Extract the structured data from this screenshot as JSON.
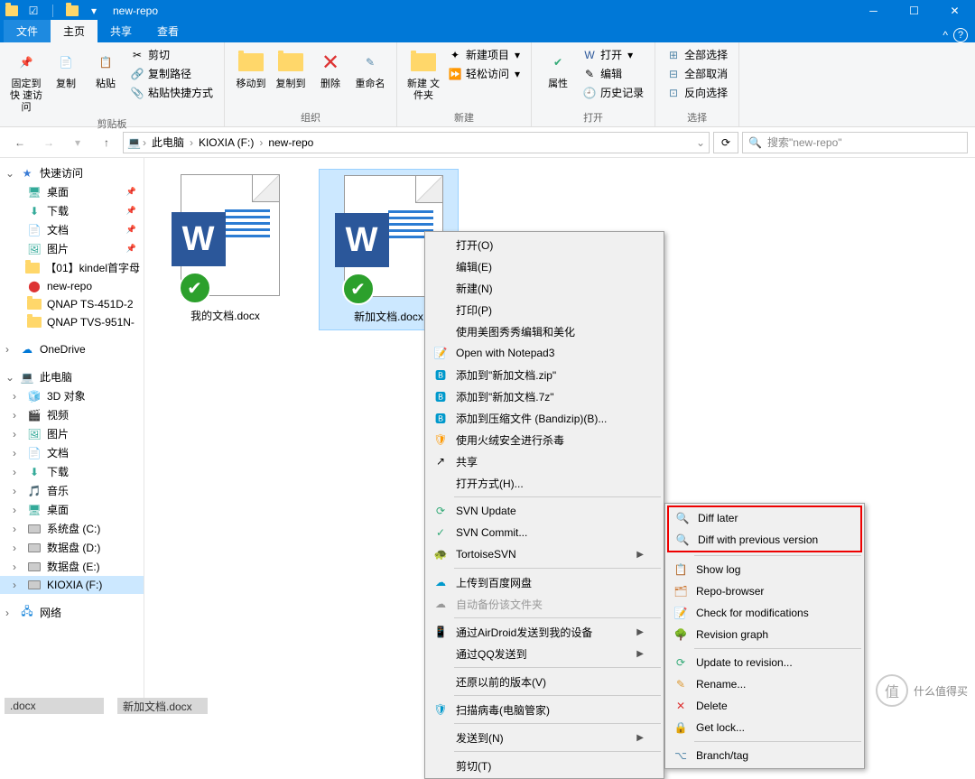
{
  "window": {
    "title": "new-repo"
  },
  "tabs": {
    "file": "文件",
    "home": "主页",
    "share": "共享",
    "view": "查看"
  },
  "ribbon": {
    "clipboard": {
      "label": "剪贴板",
      "pin": "固定到快\n速访问",
      "copy": "复制",
      "paste": "粘贴",
      "cut": "剪切",
      "copypath": "复制路径",
      "pasteshortcut": "粘贴快捷方式"
    },
    "organize": {
      "label": "组织",
      "moveto": "移动到",
      "copyto": "复制到",
      "delete": "删除",
      "rename": "重命名"
    },
    "new": {
      "label": "新建",
      "newfolder": "新建\n文件夹",
      "newitem": "新建项目",
      "easyaccess": "轻松访问"
    },
    "open": {
      "label": "打开",
      "properties": "属性",
      "open": "打开",
      "edit": "编辑",
      "history": "历史记录"
    },
    "select": {
      "label": "选择",
      "selectall": "全部选择",
      "selectnone": "全部取消",
      "invert": "反向选择"
    }
  },
  "breadcrumb": {
    "thispc": "此电脑",
    "drive": "KIOXIA (F:)",
    "folder": "new-repo"
  },
  "search": {
    "placeholder": "搜索\"new-repo\""
  },
  "sidebar": {
    "quickaccess": "快速访问",
    "desktop": "桌面",
    "downloads": "下载",
    "documents": "文档",
    "pictures": "图片",
    "kindel": "【01】kindel首字母",
    "newrepo": "new-repo",
    "qnap1": "QNAP TS-451D-2",
    "qnap2": "QNAP TVS-951N-",
    "onedrive": "OneDrive",
    "thispc": "此电脑",
    "obj3d": "3D 对象",
    "videos": "视频",
    "pictures2": "图片",
    "documents2": "文档",
    "downloads2": "下载",
    "music": "音乐",
    "desktop2": "桌面",
    "sysdisk": "系统盘 (C:)",
    "datadisk1": "数据盘 (D:)",
    "datadisk2": "数据盘 (E:)",
    "kioxia": "KIOXIA (F:)",
    "network": "网络"
  },
  "files": {
    "file1": "我的文档.docx",
    "file2": "新加文档.docx"
  },
  "contextmenu": {
    "open": "打开(O)",
    "edit": "编辑(E)",
    "new": "新建(N)",
    "print": "打印(P)",
    "meitu": "使用美图秀秀编辑和美化",
    "notepad3": "Open with Notepad3",
    "addzip": "添加到\"新加文档.zip\"",
    "add7z": "添加到\"新加文档.7z\"",
    "addbandizip": "添加到压缩文件 (Bandizip)(B)...",
    "huorong": "使用火绒安全进行杀毒",
    "share": "共享",
    "openwith": "打开方式(H)...",
    "svnupdate": "SVN Update",
    "svncommit": "SVN Commit...",
    "tortoisesvn": "TortoiseSVN",
    "baidu": "上传到百度网盘",
    "autobackup": "自动备份该文件夹",
    "airdroid": "通过AirDroid发送到我的设备",
    "qq": "通过QQ发送到",
    "restore": "还原以前的版本(V)",
    "scanvirus": "扫描病毒(电脑管家)",
    "sendto": "发送到(N)",
    "cut": "剪切(T)"
  },
  "submenu": {
    "difflater": "Diff later",
    "diffprev": "Diff with previous version",
    "showlog": "Show log",
    "repobrowser": "Repo-browser",
    "checkmods": "Check for modifications",
    "revisiongraph": "Revision graph",
    "updaterev": "Update to revision...",
    "rename": "Rename...",
    "delete": "Delete",
    "getlock": "Get lock...",
    "branchtag": "Branch/tag"
  },
  "watermark": "什么值得买",
  "bottom": {
    "left": ".docx",
    "right": "新加文档.docx"
  }
}
